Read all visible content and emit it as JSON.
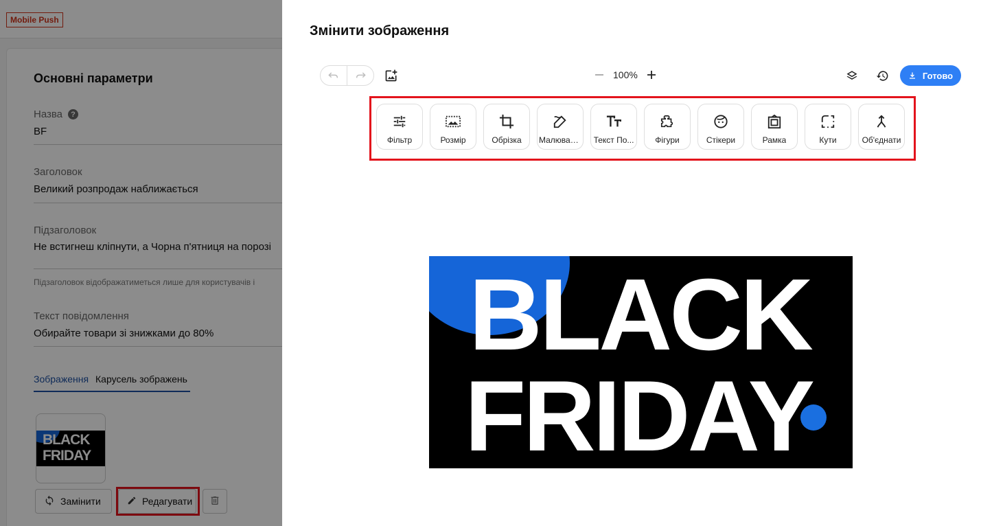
{
  "app": {
    "badge": "Mobile Push"
  },
  "form": {
    "section_title": "Основні параметри",
    "name_label": "Назва",
    "name_value": "BF",
    "heading_label": "Заголовок",
    "heading_value": "Великий розпродаж наближається",
    "subheading_label": "Підзаголовок",
    "subheading_value": "Не встигнеш кліпнути, а Чорна п'ятниця на порозі",
    "subheading_hint": "Підзаголовок відображатиметься лише для користувачів i",
    "message_label": "Текст повідомлення",
    "message_value": "Обирайте товари зі знижками до 80%",
    "tabs": [
      "Зображення",
      "Карусель зображень"
    ],
    "thumbnail_text": [
      "BLACK",
      "FRIDAY"
    ],
    "replace_label": "Замінити",
    "edit_label": "Редагувати"
  },
  "editor": {
    "title": "Змінити зображення",
    "zoom": "100%",
    "done_label": "Готово",
    "tools": [
      {
        "label": "Фільтр",
        "icon": "sliders-icon"
      },
      {
        "label": "Розмір",
        "icon": "resize-icon"
      },
      {
        "label": "Обрізка",
        "icon": "crop-icon"
      },
      {
        "label": "Малювання",
        "icon": "draw-icon"
      },
      {
        "label": "Текст По...",
        "icon": "text-icon"
      },
      {
        "label": "Фігури",
        "icon": "shapes-icon"
      },
      {
        "label": "Стікери",
        "icon": "sticker-icon"
      },
      {
        "label": "Рамка",
        "icon": "frame-icon"
      },
      {
        "label": "Кути",
        "icon": "corners-icon"
      },
      {
        "label": "Об'єднати",
        "icon": "merge-icon"
      }
    ],
    "image_text": [
      "BLACK",
      "FRIDAY"
    ]
  },
  "colors": {
    "accent": "#2e7ff5",
    "highlight": "#e3131c",
    "badge": "#d0341b",
    "image_blue": "#1565d8"
  }
}
